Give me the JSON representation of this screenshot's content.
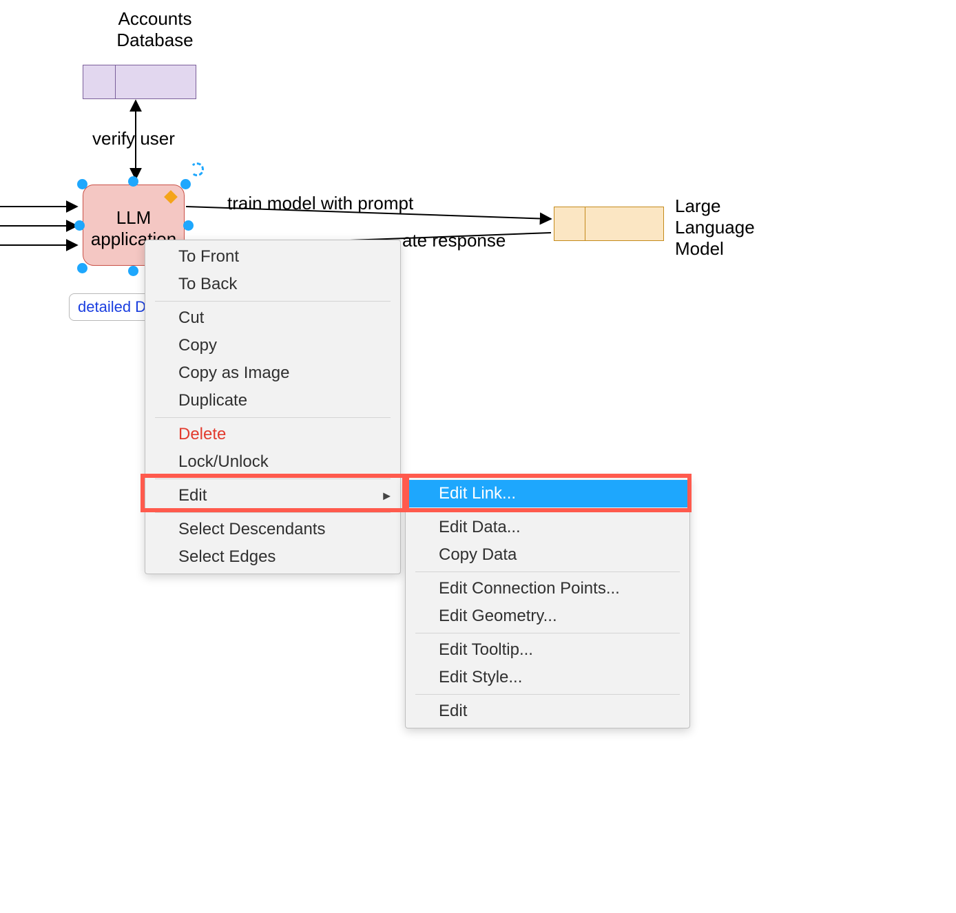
{
  "nodes": {
    "accounts_db_label": "Accounts\nDatabase",
    "llm_app_label": "LLM\napplication",
    "llm_model_label": "Large\nLanguage\nModel",
    "link_button_label": "detailed D",
    "detailed_link_truncated": "detailed D"
  },
  "edges": {
    "verify_user": "verify user",
    "train_model": "train model with prompt",
    "gen_response_partial": "ate response"
  },
  "context_menu": {
    "items": [
      {
        "id": "to-front",
        "label": "To Front"
      },
      {
        "id": "to-back",
        "label": "To Back"
      },
      {
        "sep": true
      },
      {
        "id": "cut",
        "label": "Cut"
      },
      {
        "id": "copy",
        "label": "Copy"
      },
      {
        "id": "copy-image",
        "label": "Copy as Image"
      },
      {
        "id": "duplicate",
        "label": "Duplicate"
      },
      {
        "sep": true
      },
      {
        "id": "delete",
        "label": "Delete",
        "danger": true
      },
      {
        "id": "lock",
        "label": "Lock/Unlock"
      },
      {
        "sep": true
      },
      {
        "id": "edit",
        "label": "Edit",
        "submenu": true,
        "highlighted": true
      },
      {
        "sep": true
      },
      {
        "id": "select-desc",
        "label": "Select Descendants"
      },
      {
        "id": "select-edges",
        "label": "Select Edges"
      }
    ]
  },
  "edit_submenu": {
    "items": [
      {
        "id": "edit-link",
        "label": "Edit Link...",
        "active": true,
        "highlighted": true
      },
      {
        "sep": true
      },
      {
        "id": "edit-data",
        "label": "Edit Data..."
      },
      {
        "id": "copy-data",
        "label": "Copy Data"
      },
      {
        "sep": true
      },
      {
        "id": "edit-conn",
        "label": "Edit Connection Points..."
      },
      {
        "id": "edit-geom",
        "label": "Edit Geometry..."
      },
      {
        "sep": true
      },
      {
        "id": "edit-tooltip",
        "label": "Edit Tooltip..."
      },
      {
        "id": "edit-style",
        "label": "Edit Style..."
      },
      {
        "sep": true
      },
      {
        "id": "edit-plain",
        "label": "Edit"
      }
    ]
  }
}
